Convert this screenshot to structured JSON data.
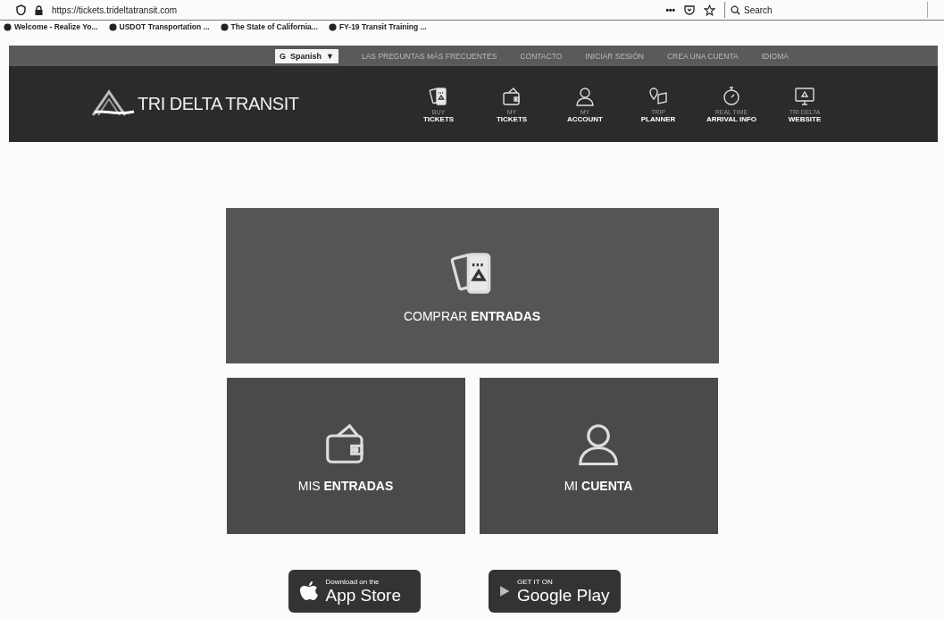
{
  "browser": {
    "url": "https://tickets.trideltatransit.com",
    "menu": "•••",
    "search_placeholder": "Search"
  },
  "bookmarks": [
    {
      "label": "Welcome - Realize Yo..."
    },
    {
      "label": "USDOT Transportation ..."
    },
    {
      "label": "The State of California..."
    },
    {
      "label": "FY-19 Transit Training ..."
    }
  ],
  "language_select": {
    "badge": "G",
    "value": "Spanish",
    "caret": "▼"
  },
  "top_links": [
    "LAS PREGUNTAS MÁS FRECUENTES",
    "CONTACTO",
    "INICIAR SESIÓN",
    "CREA UNA CUENTA",
    "IDIOMA"
  ],
  "logo": "TRI DELTA TRANSIT",
  "nav": [
    {
      "kind": "ticket",
      "line1": "BUY",
      "line2": "TICKETS"
    },
    {
      "kind": "wallet",
      "line1": "MY",
      "line2": "TICKETS"
    },
    {
      "kind": "user",
      "line1": "MY",
      "line2": "ACCOUNT"
    },
    {
      "kind": "pin",
      "line1": "TRIP",
      "line2": "PLANNER"
    },
    {
      "kind": "clock",
      "line1": "REAL TIME",
      "line2": "ARRIVAL INFO"
    },
    {
      "kind": "monitor",
      "line1": "TRI DELTA",
      "line2": "WEBSITE"
    }
  ],
  "tiles": [
    {
      "kind": "ticket",
      "label": "COMPRAR **ENTRADAS**"
    },
    {
      "kind": "wallet",
      "label": "MIS **ENTRADAS**"
    },
    {
      "kind": "user",
      "label": "MI **CUENTA**"
    }
  ],
  "stores": [
    {
      "kind": "apple",
      "small": "Download on the",
      "big": "App Store"
    },
    {
      "kind": "play",
      "small": "GET IT ON",
      "big": "Google Play"
    }
  ]
}
